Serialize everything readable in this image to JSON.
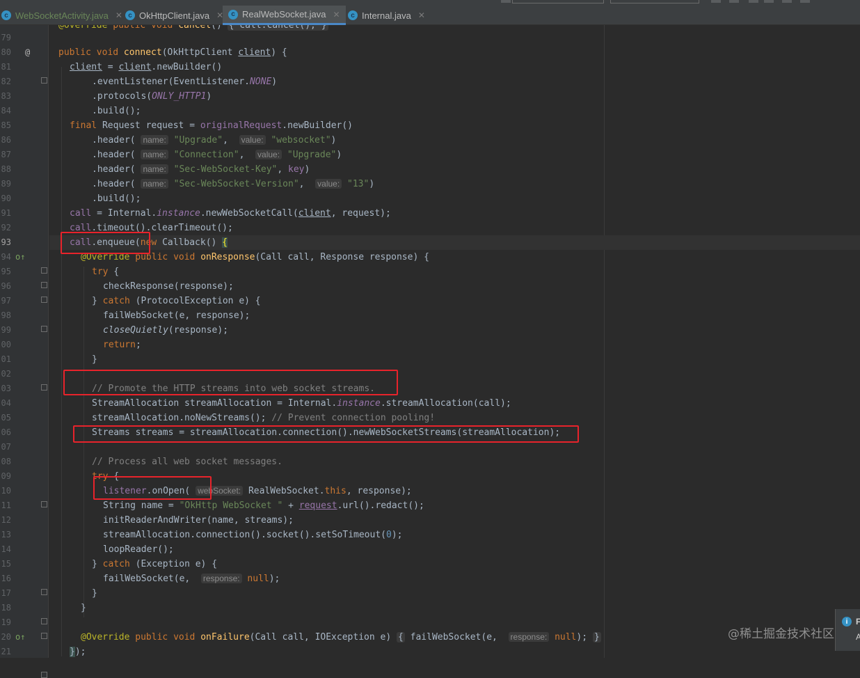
{
  "tabs": [
    {
      "label": "WebSocketActivity.java",
      "icon": "java-class-icon"
    },
    {
      "label": "OkHttpClient.java",
      "icon": "java-class-icon"
    },
    {
      "label": "RealWebSocket.java",
      "icon": "java-class-icon",
      "active": true
    },
    {
      "label": "Internal.java",
      "icon": "java-class-icon"
    }
  ],
  "gutter": {
    "line_numbers": [
      "79",
      "80",
      "81",
      "82",
      "83",
      "84",
      "85",
      "86",
      "87",
      "88",
      "89",
      "90",
      "91",
      "92",
      "93",
      "94",
      "95",
      "96",
      "97",
      "98",
      "99",
      "00",
      "01",
      "02",
      "03",
      "04",
      "05",
      "06",
      "07",
      "08",
      "09",
      "10",
      "11",
      "12",
      "13",
      "14",
      "15",
      "16",
      "17",
      "18",
      "19",
      "20",
      "21"
    ],
    "override_marker": "@",
    "current_line": "93"
  },
  "code": {
    "top_line": "@Override public void cancel() { call.cancel(); }",
    "header_args": {
      "upgrade": "\"Upgrade\"",
      "websocket": "\"websocket\"",
      "connection": "\"Connection\"",
      "upgrade2": "\"Upgrade\"",
      "sec_key": "\"Sec-WebSocket-Key\"",
      "sec_version": "\"Sec-WebSocket-Version\"",
      "v13": "\"13\""
    },
    "hints": {
      "name": "name:",
      "value": "value:",
      "websocket": "webSocket:",
      "response": "response:"
    },
    "comments": {
      "promote": "// Promote the HTTP streams into web socket streams.",
      "prevent": "// Prevent connection pooling!",
      "process": "// Process all web socket messages."
    },
    "string_okhttp": "\"OkHttp WebSocket \""
  },
  "watermark": "@稀土掘金技术社区",
  "notification": {
    "title": "F",
    "body": "A"
  }
}
